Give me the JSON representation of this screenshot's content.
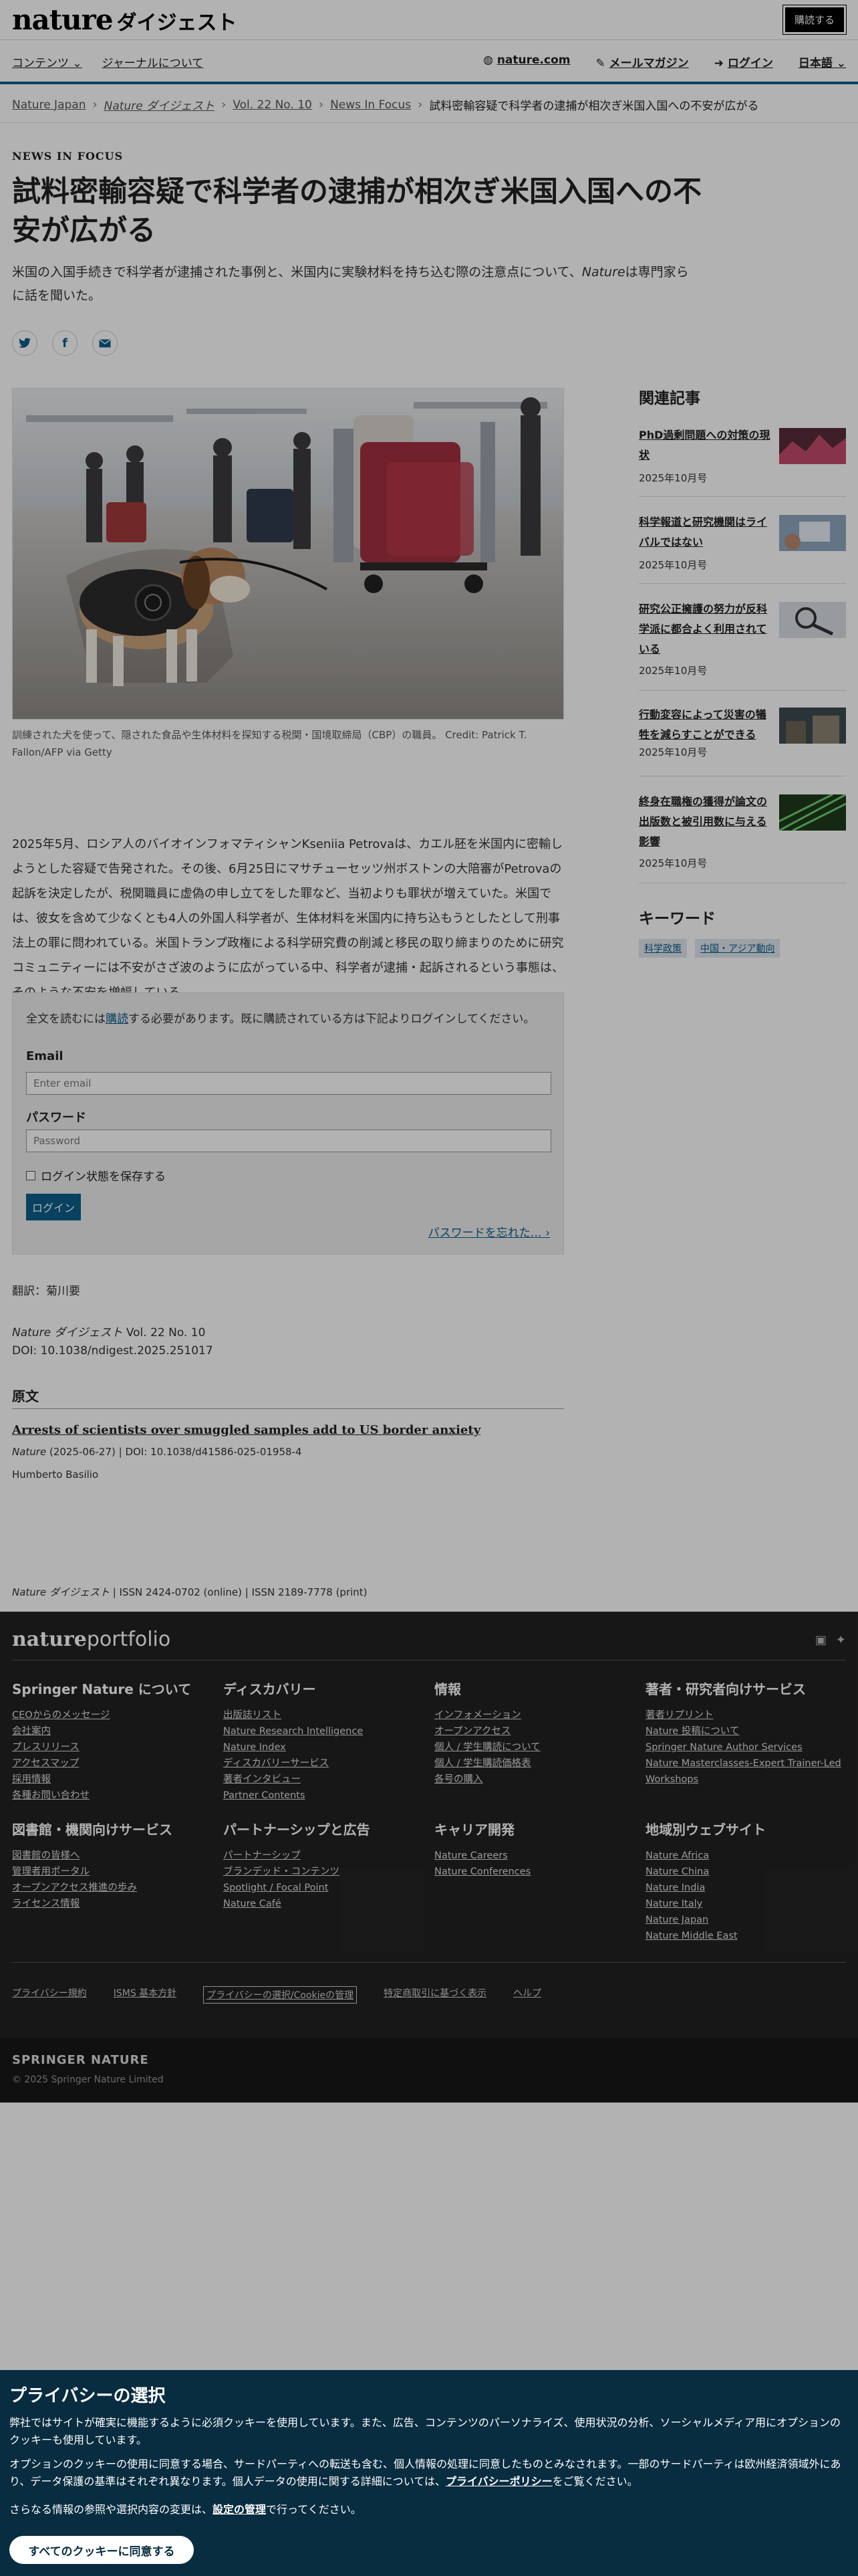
{
  "header": {
    "logo_main": "nature",
    "logo_sub": "ダイジェスト",
    "subscribe": "購読する"
  },
  "nav": {
    "left": [
      "コンテンツ ⌄",
      "ジャーナルについて"
    ],
    "site": "nature.com",
    "mail": "メールマガジン",
    "login": "ログイン",
    "lang": "日本語 ⌄"
  },
  "breadcrumb": [
    "Nature Japan",
    "Nature ダイジェスト",
    "Vol. 22 No. 10",
    "News In Focus",
    "試料密輸容疑で科学者の逮捕が相次ぎ米国入国への不安が広がる"
  ],
  "article": {
    "kicker": "NEWS IN FOCUS",
    "title": "試料密輸容疑で科学者の逮捕が相次ぎ米国入国への不安が広がる",
    "standfirst_pre": "米国の入国手続きで科学者が逮捕された事例と、米国内に実験材料を持ち込む際の注意点について、",
    "standfirst_em": "Nature",
    "standfirst_post": "は専門家らに話を聞いた。",
    "caption": "訓練された犬を使って、隠された食品や生体材料を探知する税関・国境取締局（CBP）の職員。 Credit: Patrick T. Fallon/AFP via Getty",
    "body": "2025年5月、ロシア人のバイオインフォマティシャンKseniia Petrovaは、カエル胚を米国内に密輸しようとした容疑で告発された。その後、6月25日にマサチューセッツ州ボストンの大陪審がPetrovaの起訴を決定したが、税関職員に虚偽の申し立てをした罪など、当初よりも罪状が増えていた。米国では、彼女を含めて少なくとも4人の外国人科学者が、生体材料を米国内に持ち込もうとしたとして刑事法上の罪に問われている。米国トランプ政権による科学研究費の削減と移民の取り締まりのために研究コミュニティーには不安がさざ波のように広がっている中、科学者が逮捕・起訴されるという事態は、そのような不安を増幅している。"
  },
  "paywall": {
    "msg_pre": "全文を読むには",
    "msg_link": "購読",
    "msg_post": "する必要があります。既に購読されている方は下記よりログインしてください。",
    "email_label": "Email",
    "email_placeholder": "Enter email",
    "password_label": "パスワード",
    "password_placeholder": "Password",
    "remember": "ログイン状態を保存する",
    "login": "ログイン",
    "forgot": "パスワードを忘れた…"
  },
  "meta": {
    "translator": "翻訳：菊川要",
    "journal_em": "Nature ダイジェスト",
    "volume": "Vol. 22 No. 10",
    "doi": "DOI: 10.1038/ndigest.2025.251017"
  },
  "original": {
    "heading": "原文",
    "title": "Arrests of scientists over smuggled samples add to US border anxiety",
    "cite_em": "Nature",
    "cite": " (2025-06-27) | DOI: 10.1038/d41586-025-01958-4",
    "author": "Humberto Basilio"
  },
  "issn": {
    "em": "Nature ダイジェスト",
    "text": " | ISSN 2424-0702 (online) | ISSN 2189-7778 (print)"
  },
  "sidebar": {
    "related_heading": "関連記事",
    "related": [
      {
        "title": "PhD過剰問題への対策の現状",
        "date": "2025年10月号"
      },
      {
        "title": "科学報道と研究機関はライバルではない",
        "date": "2025年10月号"
      },
      {
        "title": "研究公正擁護の努力が反科学派に都合よく利用されている",
        "date": "2025年10月号"
      },
      {
        "title": "行動変容によって災害の犠牲を減らすことができる",
        "date": "2025年10月号"
      },
      {
        "title": "終身在職権の獲得が論文の出版数と被引用数に与える影響",
        "date": "2025年10月号"
      }
    ],
    "keywords_heading": "キーワード",
    "keywords": [
      "科学政策",
      "中国・アジア動向"
    ]
  },
  "footer": {
    "logo_a": "nature",
    "logo_b": "portfolio",
    "columns": [
      {
        "title": "Springer Nature について",
        "links": [
          "CEOからのメッセージ",
          "会社案内",
          "プレスリリース",
          "アクセスマップ",
          "採用情報",
          "各種お問い合わせ"
        ]
      },
      {
        "title": "ディスカバリー",
        "links": [
          "出版誌リスト",
          "Nature Research Intelligence",
          "Nature Index",
          "ディスカバリーサービス",
          "著者インタビュー",
          "Partner Contents"
        ]
      },
      {
        "title": "情報",
        "links": [
          "インフォメーション",
          "オープンアクセス",
          "個人 / 学生購読について",
          "個人 / 学生購読価格表",
          "各号の購入"
        ]
      },
      {
        "title": "著者・研究者向けサービス",
        "links": [
          "著者リプリント",
          "Nature 投稿について",
          "Springer Nature Author Services",
          "Nature Masterclasses-Expert Trainer-Led Workshops"
        ]
      },
      {
        "title": "図書館・機関向けサービス",
        "links": [
          "図書館の皆様へ",
          "管理者用ポータル",
          "オープンアクセス推進の歩み",
          "ライセンス情報"
        ]
      },
      {
        "title": "パートナーシップと広告",
        "links": [
          "パートナーシップ",
          "ブランデッド・コンテンツ",
          "Spotlight / Focal Point",
          "Nature Café"
        ]
      },
      {
        "title": "キャリア開発",
        "links": [
          "Nature Careers",
          "Nature Conferences"
        ]
      },
      {
        "title": "地域別ウェブサイト",
        "links": [
          "Nature Africa",
          "Nature China",
          "Nature India",
          "Nature Italy",
          "Nature Japan",
          "Nature Middle East"
        ]
      }
    ],
    "bottom_links": [
      "プライバシー規約",
      "ISMS 基本方針",
      "プライバシーの選択/Cookieの管理",
      "特定商取引に基づく表示",
      "ヘルプ"
    ],
    "sn_logo": "SPRINGER NATURE",
    "copyright": "© 2025 Springer Nature Limited"
  },
  "cookie": {
    "title": "プライバシーの選択",
    "p1": "弊社ではサイトが確実に機能するように必須クッキーを使用しています。また、広告、コンテンツのパーソナライズ、使用状況の分析、ソーシャルメディア用にオプションのクッキーも使用しています。",
    "p2_pre": "オプションのクッキーの使用に同意する場合、サードパーティへの転送も含む、個人情報の処理に同意したものとみなされます。一部のサードパーティは欧州経済領域外にあり、データ保護の基準はそれぞれ異なります。個人データの使用に関する詳細については、",
    "p2_link": "プライバシーポリシー",
    "p2_post": "をご覧ください。",
    "p3_pre": "さらなる情報の参照や選択内容の変更は、",
    "p3_link": "設定の管理",
    "p3_post": "で行ってください。",
    "accept": "すべてのクッキーに同意する"
  },
  "colors": {
    "brand": "#0d5d8a",
    "cookie_bg": "#082c40",
    "footer_bg": "#222222"
  }
}
